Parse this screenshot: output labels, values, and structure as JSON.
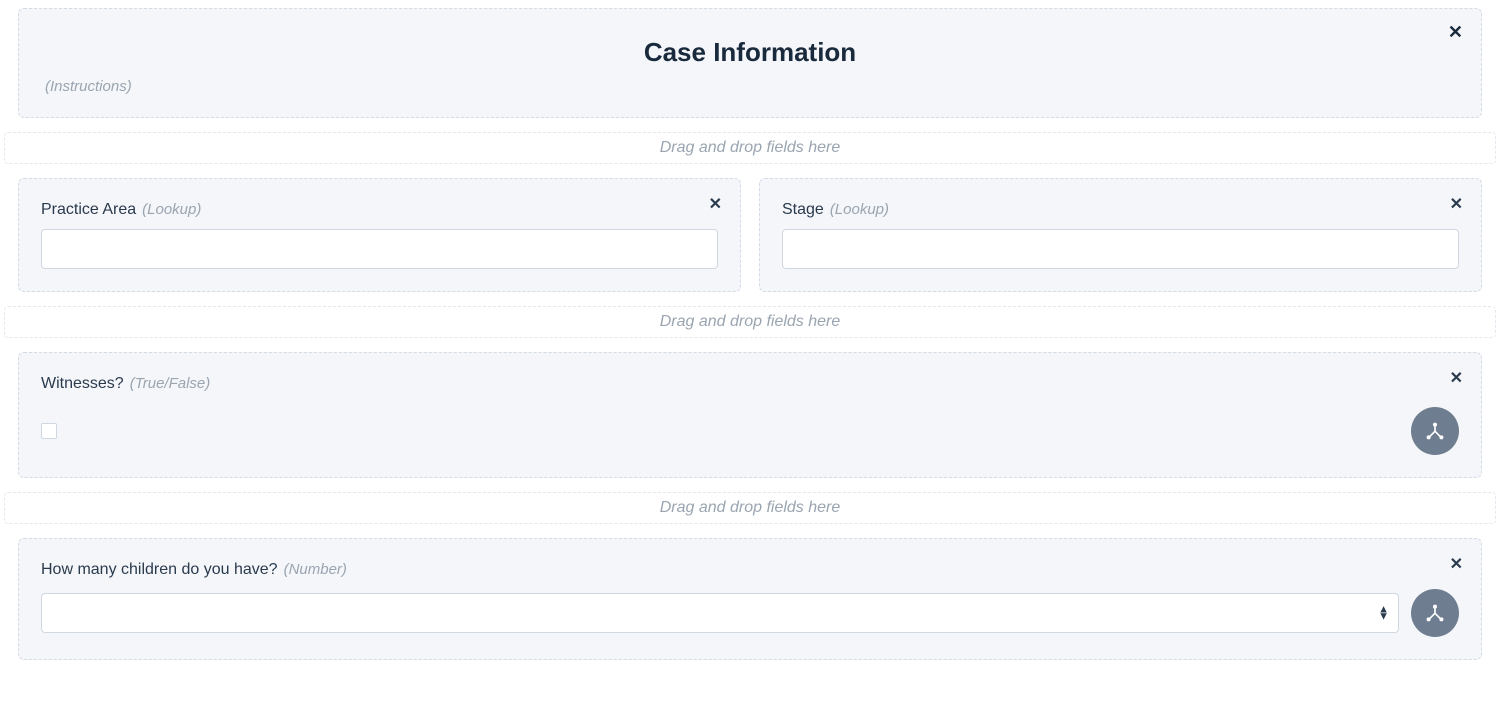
{
  "header": {
    "title": "Case Information",
    "instructions": "(Instructions)"
  },
  "dropzone_text": "Drag and drop fields here",
  "fields": {
    "practice_area": {
      "label": "Practice Area",
      "type": "(Lookup)",
      "value": ""
    },
    "stage": {
      "label": "Stage",
      "type": "(Lookup)",
      "value": ""
    },
    "witnesses": {
      "label": "Witnesses?",
      "type": "(True/False)",
      "checked": false
    },
    "children": {
      "label": "How many children do you have?",
      "type": "(Number)",
      "value": ""
    }
  }
}
